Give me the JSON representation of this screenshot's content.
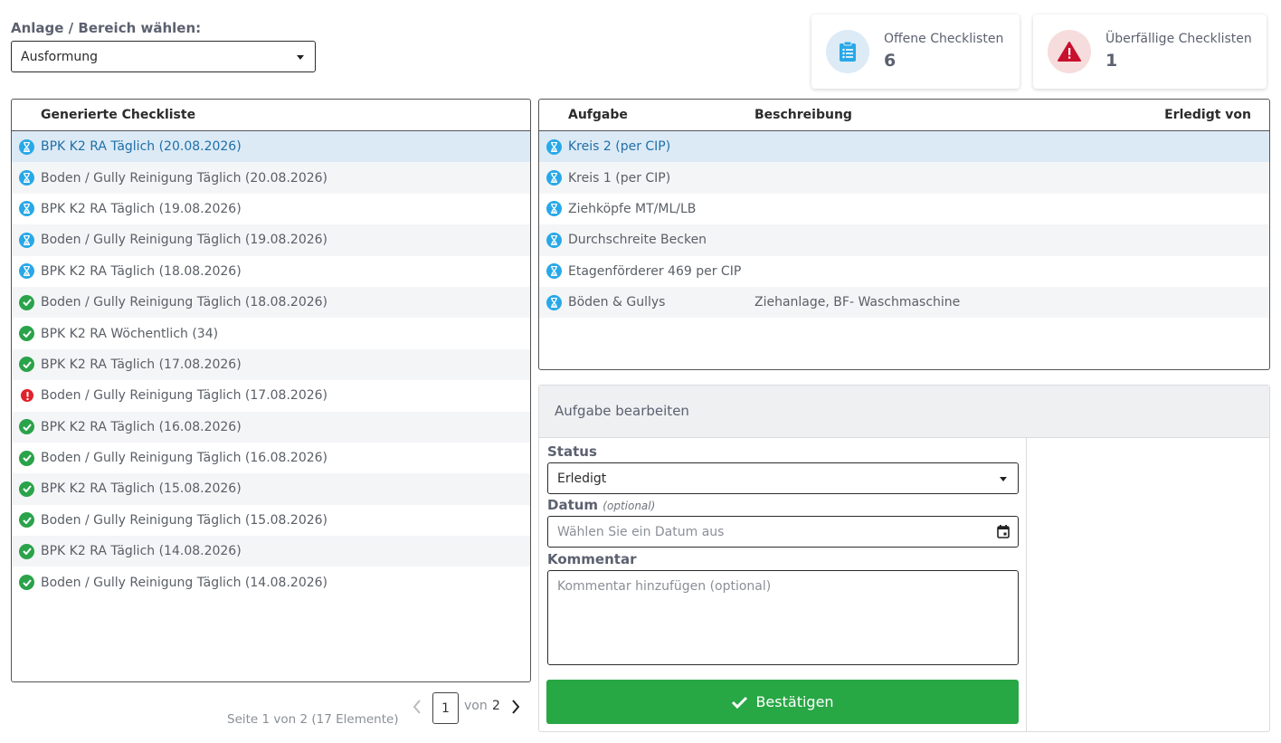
{
  "anlage": {
    "label": "Anlage / Bereich wählen:",
    "selected": "Ausformung"
  },
  "stats": {
    "open": {
      "title": "Offene Checklisten",
      "value": "6",
      "icon": "clipboard-list-icon",
      "color": "#29a8e8"
    },
    "overdue": {
      "title": "Überfällige Checklisten",
      "value": "1",
      "icon": "warning-triangle-icon",
      "color": "#c8102e"
    }
  },
  "checklists": {
    "header": "Generierte Checkliste",
    "items": [
      {
        "label": "BPK K2 RA Täglich (20.08.2026)",
        "status": "pending"
      },
      {
        "label": "Boden / Gully Reinigung Täglich (20.08.2026)",
        "status": "pending"
      },
      {
        "label": "BPK K2 RA Täglich (19.08.2026)",
        "status": "pending"
      },
      {
        "label": "Boden / Gully Reinigung Täglich (19.08.2026)",
        "status": "pending"
      },
      {
        "label": "BPK K2 RA Täglich (18.08.2026)",
        "status": "pending"
      },
      {
        "label": "Boden / Gully Reinigung Täglich (18.08.2026)",
        "status": "done"
      },
      {
        "label": "BPK K2 RA Wöchentlich (34)",
        "status": "done"
      },
      {
        "label": "BPK K2 RA Täglich (17.08.2026)",
        "status": "done"
      },
      {
        "label": "Boden / Gully Reinigung Täglich (17.08.2026)",
        "status": "overdue"
      },
      {
        "label": "BPK K2 RA Täglich (16.08.2026)",
        "status": "done"
      },
      {
        "label": "Boden / Gully Reinigung Täglich (16.08.2026)",
        "status": "done"
      },
      {
        "label": "BPK K2 RA Täglich (15.08.2026)",
        "status": "done"
      },
      {
        "label": "Boden / Gully Reinigung Täglich (15.08.2026)",
        "status": "done"
      },
      {
        "label": "BPK K2 RA Täglich (14.08.2026)",
        "status": "done"
      },
      {
        "label": "Boden / Gully Reinigung Täglich (14.08.2026)",
        "status": "done"
      }
    ]
  },
  "pager": {
    "info": "Seite 1 von 2 (17 Elemente)",
    "current": "1",
    "von": "von",
    "total": "2"
  },
  "tasks": {
    "headers": {
      "task": "Aufgabe",
      "description": "Beschreibung",
      "done_by": "Erledigt von"
    },
    "items": [
      {
        "task": "Kreis 2 (per CIP)",
        "description": "",
        "status": "pending"
      },
      {
        "task": "Kreis 1 (per CIP)",
        "description": "",
        "status": "pending"
      },
      {
        "task": "Ziehköpfe MT/ML/LB",
        "description": "",
        "status": "pending"
      },
      {
        "task": "Durchschreite Becken",
        "description": "",
        "status": "pending"
      },
      {
        "task": "Etagenförderer 469 per CIP",
        "description": "",
        "status": "pending"
      },
      {
        "task": "Böden & Gullys",
        "description": "Ziehanlage, BF- Waschmaschine",
        "status": "pending"
      }
    ]
  },
  "edit": {
    "title": "Aufgabe bearbeiten",
    "status_label": "Status",
    "status_value": "Erledigt",
    "date_label": "Datum",
    "date_optional": "(optional)",
    "date_placeholder": "Wählen Sie ein Datum aus",
    "comment_label": "Kommentar",
    "comment_placeholder": "Kommentar hinzufügen (optional)",
    "confirm_label": "Bestätigen"
  }
}
